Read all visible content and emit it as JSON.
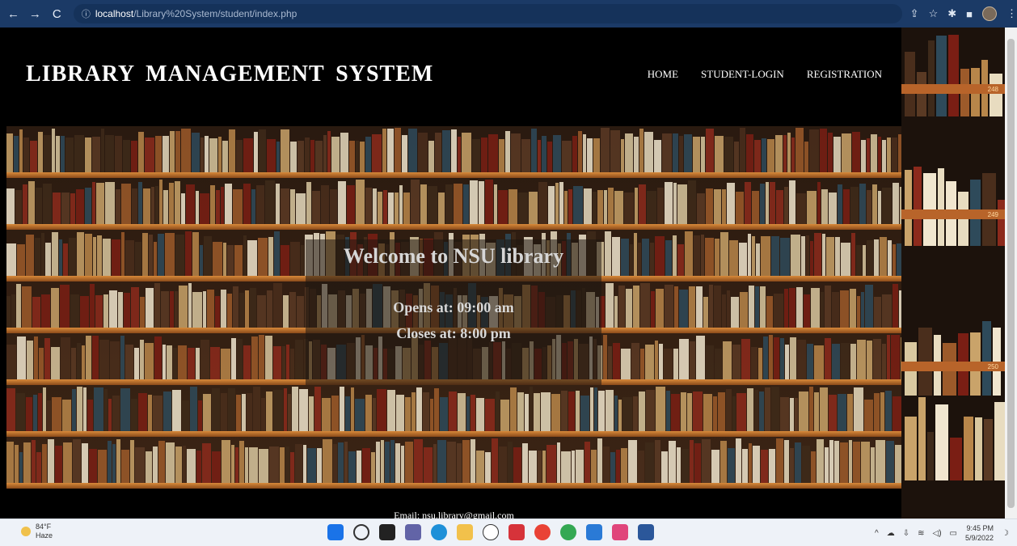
{
  "browser": {
    "back_icon": "back-arrow-icon",
    "forward_icon": "forward-arrow-icon",
    "reload_icon": "reload-icon",
    "url_host": "localhost",
    "url_path": "/Library%20System/student/index.php"
  },
  "site": {
    "title": "LIBRARY MANAGEMENT SYSTEM",
    "nav": [
      "HOME",
      "STUDENT-LOGIN",
      "REGISTRATION"
    ]
  },
  "hero": {
    "welcome": "Welcome to NSU library",
    "opens": "Opens at: 09:00 am",
    "closes": "Closes at: 8:00 pm"
  },
  "footer": {
    "email": "Email: nsu.library@gmail.com"
  },
  "side_shelf": {
    "labels": [
      "248",
      "249",
      "250"
    ]
  },
  "taskbar": {
    "temp": "84°F",
    "weather": "Haze",
    "time": "9:45 PM",
    "date": "5/9/2022"
  },
  "colors": {
    "browser_bar": "#1b3a66",
    "shelf_wood": "#d88a3a"
  }
}
